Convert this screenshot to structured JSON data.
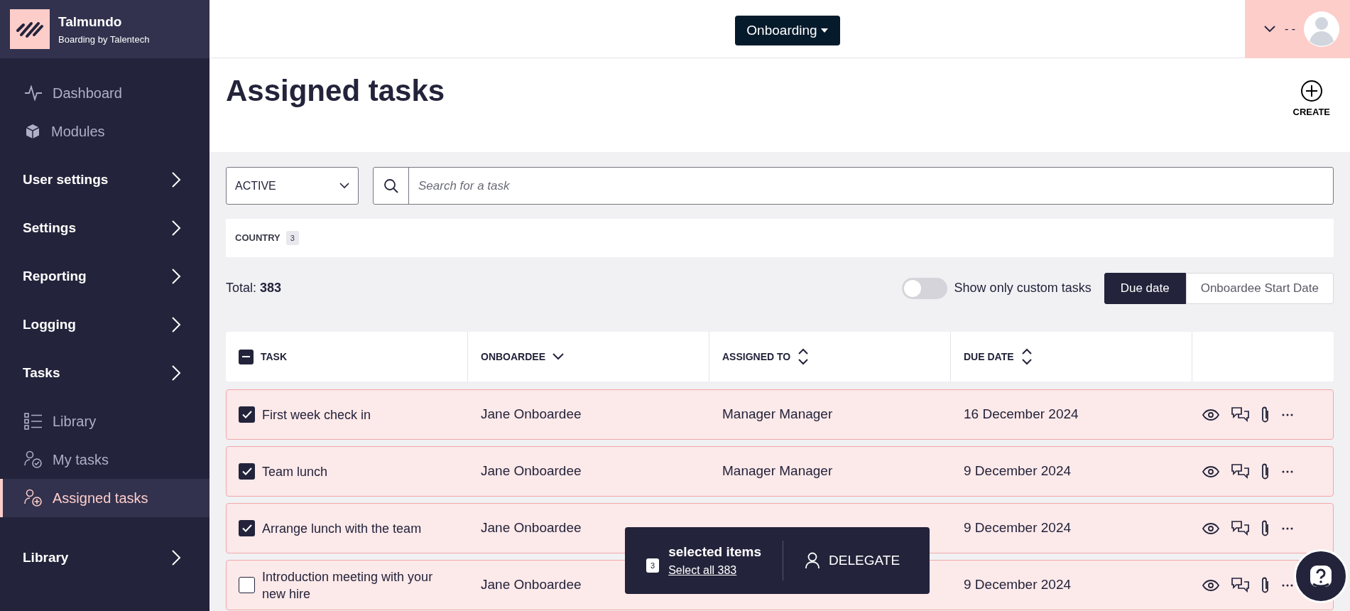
{
  "brand": {
    "name": "Talmundo",
    "tagline": "Boarding by Talentech"
  },
  "sidebar": {
    "items": [
      {
        "kind": "link",
        "label": "Dashboard",
        "selected": false
      },
      {
        "kind": "link",
        "label": "Modules",
        "selected": false
      },
      {
        "kind": "group",
        "label": "User settings"
      },
      {
        "kind": "group",
        "label": "Settings"
      },
      {
        "kind": "group",
        "label": "Reporting"
      },
      {
        "kind": "group",
        "label": "Logging"
      },
      {
        "kind": "group",
        "label": "Tasks"
      },
      {
        "kind": "link",
        "label": "Library",
        "selected": false
      },
      {
        "kind": "link",
        "label": "My tasks",
        "selected": false
      },
      {
        "kind": "link",
        "label": "Assigned tasks",
        "selected": true
      },
      {
        "kind": "group",
        "label": "Library"
      }
    ]
  },
  "header": {
    "module_button": "Onboarding",
    "user_name": "- -"
  },
  "page": {
    "title": "Assigned tasks",
    "create_label": "CREATE"
  },
  "filters": {
    "status": "ACTIVE",
    "search_placeholder": "Search for a task",
    "country_label": "COUNTRY",
    "country_count": "3"
  },
  "summary": {
    "total_label": "Total:",
    "total": "383",
    "custom_toggle": {
      "label": "Show only custom tasks",
      "on": false
    },
    "sort_options": [
      {
        "label": "Due date",
        "selected": true
      },
      {
        "label": "Onboardee Start Date",
        "selected": false
      }
    ]
  },
  "table": {
    "select_all": {
      "indeterminate": true
    },
    "columns": [
      {
        "label": "TASK",
        "sortable": false
      },
      {
        "label": "ONBOARDEE",
        "sortable": true,
        "sorted": true
      },
      {
        "label": "ASSIGNED TO",
        "sortable": true,
        "sorted": false
      },
      {
        "label": "DUE DATE",
        "sortable": true,
        "sorted": false
      }
    ],
    "rows": [
      {
        "selected": true,
        "overdue": true,
        "task": "First week check in",
        "onboardee": "Jane Onboardee",
        "assigned_to": "Manager Manager",
        "due_date": "16 December 2024"
      },
      {
        "selected": true,
        "overdue": true,
        "task": "Team lunch",
        "onboardee": "Jane Onboardee",
        "assigned_to": "Manager Manager",
        "due_date": "9 December 2024"
      },
      {
        "selected": true,
        "overdue": true,
        "task": "Arrange lunch with the team",
        "onboardee": "Jane Onboardee",
        "due_date": "9 December 2024"
      },
      {
        "selected": false,
        "overdue": true,
        "task": "Introduction meeting with your new hire",
        "onboardee": "Jane Onboardee",
        "due_date": "9 December 2024"
      }
    ]
  },
  "selection_bar": {
    "count": "3",
    "label": "selected items",
    "select_all": "Select all 383",
    "action": "DELEGATE"
  }
}
